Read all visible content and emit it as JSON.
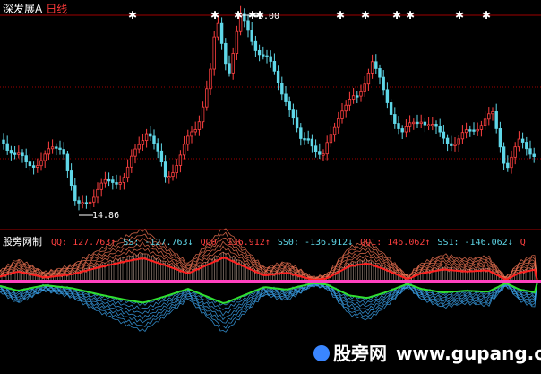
{
  "header": {
    "symbol_label": "深发展A",
    "period_label": "日线"
  },
  "price_chart": {
    "high_marker_label": "9.00",
    "low_marker_label": "14.86",
    "colors": {
      "up": "#ff4040",
      "down": "#5fd7e8",
      "marker": "#ffffff",
      "grid": "#a00000"
    }
  },
  "indicator": {
    "name": "股旁网制",
    "items": [
      {
        "text": "QQ: 127.763↑",
        "color": "#ff4040"
      },
      {
        "text": "SS: -127.763↓",
        "color": "#5fd7e8"
      },
      {
        "text": "QQ0: 136.912↑",
        "color": "#ff4040"
      },
      {
        "text": "SS0: -136.912↓",
        "color": "#5fd7e8"
      },
      {
        "text": "QQ1: 146.062↑",
        "color": "#ff4040"
      },
      {
        "text": "SS1: -146.062↓",
        "color": "#5fd7e8"
      },
      {
        "text": "Q",
        "color": "#ff4040"
      }
    ],
    "colors": {
      "upper_fill": "#e87050",
      "upper_line": "#ff2020",
      "lower_fill": "#3aa0e8",
      "lower_line": "#30e030",
      "axis": "#ff40c0"
    }
  },
  "watermark": {
    "cn": "股旁网",
    "url": "www.gupang.com"
  }
}
